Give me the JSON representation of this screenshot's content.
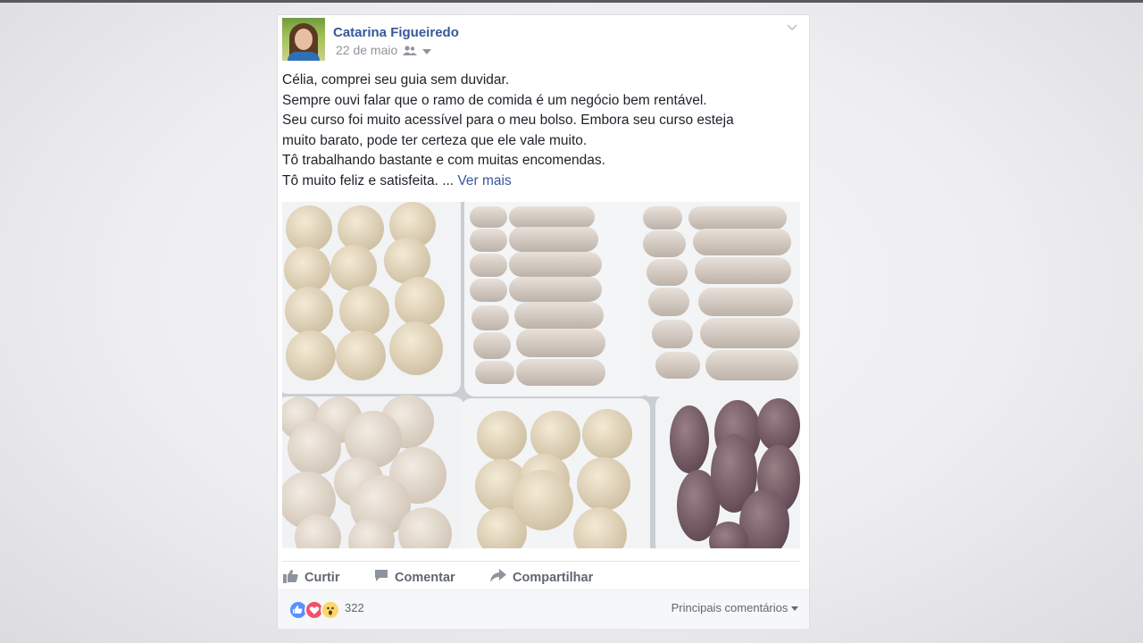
{
  "post": {
    "author": "Catarina Figueiredo",
    "date": "22 de maio",
    "body_lines": [
      "Célia, comprei seu guia sem duvidar.",
      "Sempre ouvi falar que o ramo de comida é um negócio bem rentável.",
      "Seu curso foi muito acessível para o meu bolso. Embora seu curso esteja",
      "muito barato, pode ter certeza que ele vale muito.",
      "Tô trabalhando bastante e com muitas encomendas.",
      "Tô muito feliz e satisfeita."
    ],
    "ellipsis": "...",
    "see_more": "Ver mais"
  },
  "actions": {
    "like": "Curtir",
    "comment": "Comentar",
    "share": "Compartilhar"
  },
  "footer": {
    "reaction_count": "322",
    "sort_label": "Principais comentários"
  },
  "colors": {
    "link": "#365899",
    "like_blue": "#5890ff",
    "love_red": "#f25268",
    "wow_yellow": "#fcd86a"
  },
  "icons": [
    "audience-friends-icon",
    "like-icon",
    "comment-icon",
    "share-icon",
    "reaction-like-icon",
    "reaction-love-icon",
    "reaction-wow-icon"
  ]
}
